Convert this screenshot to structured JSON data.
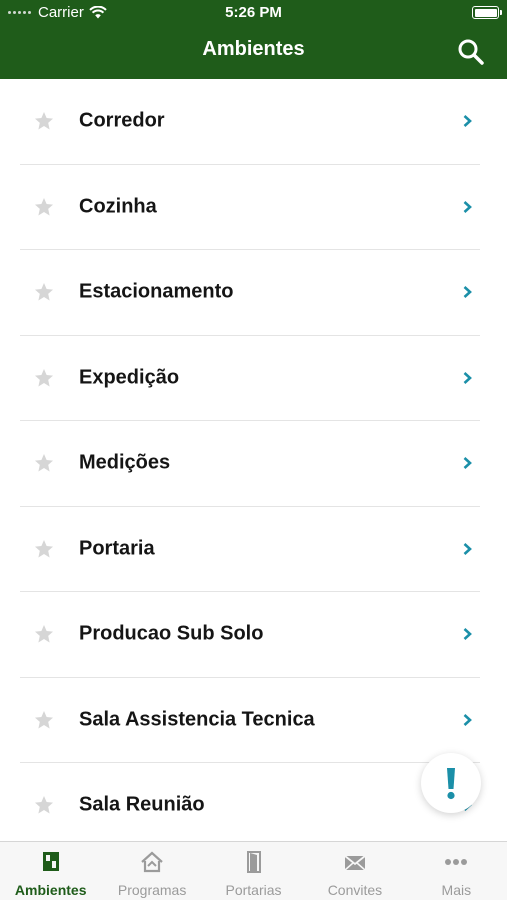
{
  "status": {
    "carrier": "Carrier",
    "time": "5:26 PM"
  },
  "nav": {
    "title": "Ambientes",
    "search_icon": "search-icon"
  },
  "colors": {
    "header": "#1f5c1a",
    "accent": "#1b8fa8",
    "star": "#d6d6d6",
    "tab_active": "#1f5c1a",
    "tab_inactive": "#9b9b9b"
  },
  "items": [
    {
      "label": "Corredor"
    },
    {
      "label": "Cozinha"
    },
    {
      "label": "Estacionamento"
    },
    {
      "label": "Expedição"
    },
    {
      "label": "Medições"
    },
    {
      "label": "Portaria"
    },
    {
      "label": "Producao Sub Solo"
    },
    {
      "label": "Sala Assistencia Tecnica"
    },
    {
      "label": "Sala Reunião"
    }
  ],
  "fab": {
    "icon": "exclamation-icon"
  },
  "tabs": [
    {
      "label": "Ambientes",
      "icon": "ambientes-icon",
      "active": true
    },
    {
      "label": "Programas",
      "icon": "programas-icon",
      "active": false
    },
    {
      "label": "Portarias",
      "icon": "door-icon",
      "active": false
    },
    {
      "label": "Convites",
      "icon": "envelope-icon",
      "active": false
    },
    {
      "label": "Mais",
      "icon": "more-icon",
      "active": false
    }
  ]
}
